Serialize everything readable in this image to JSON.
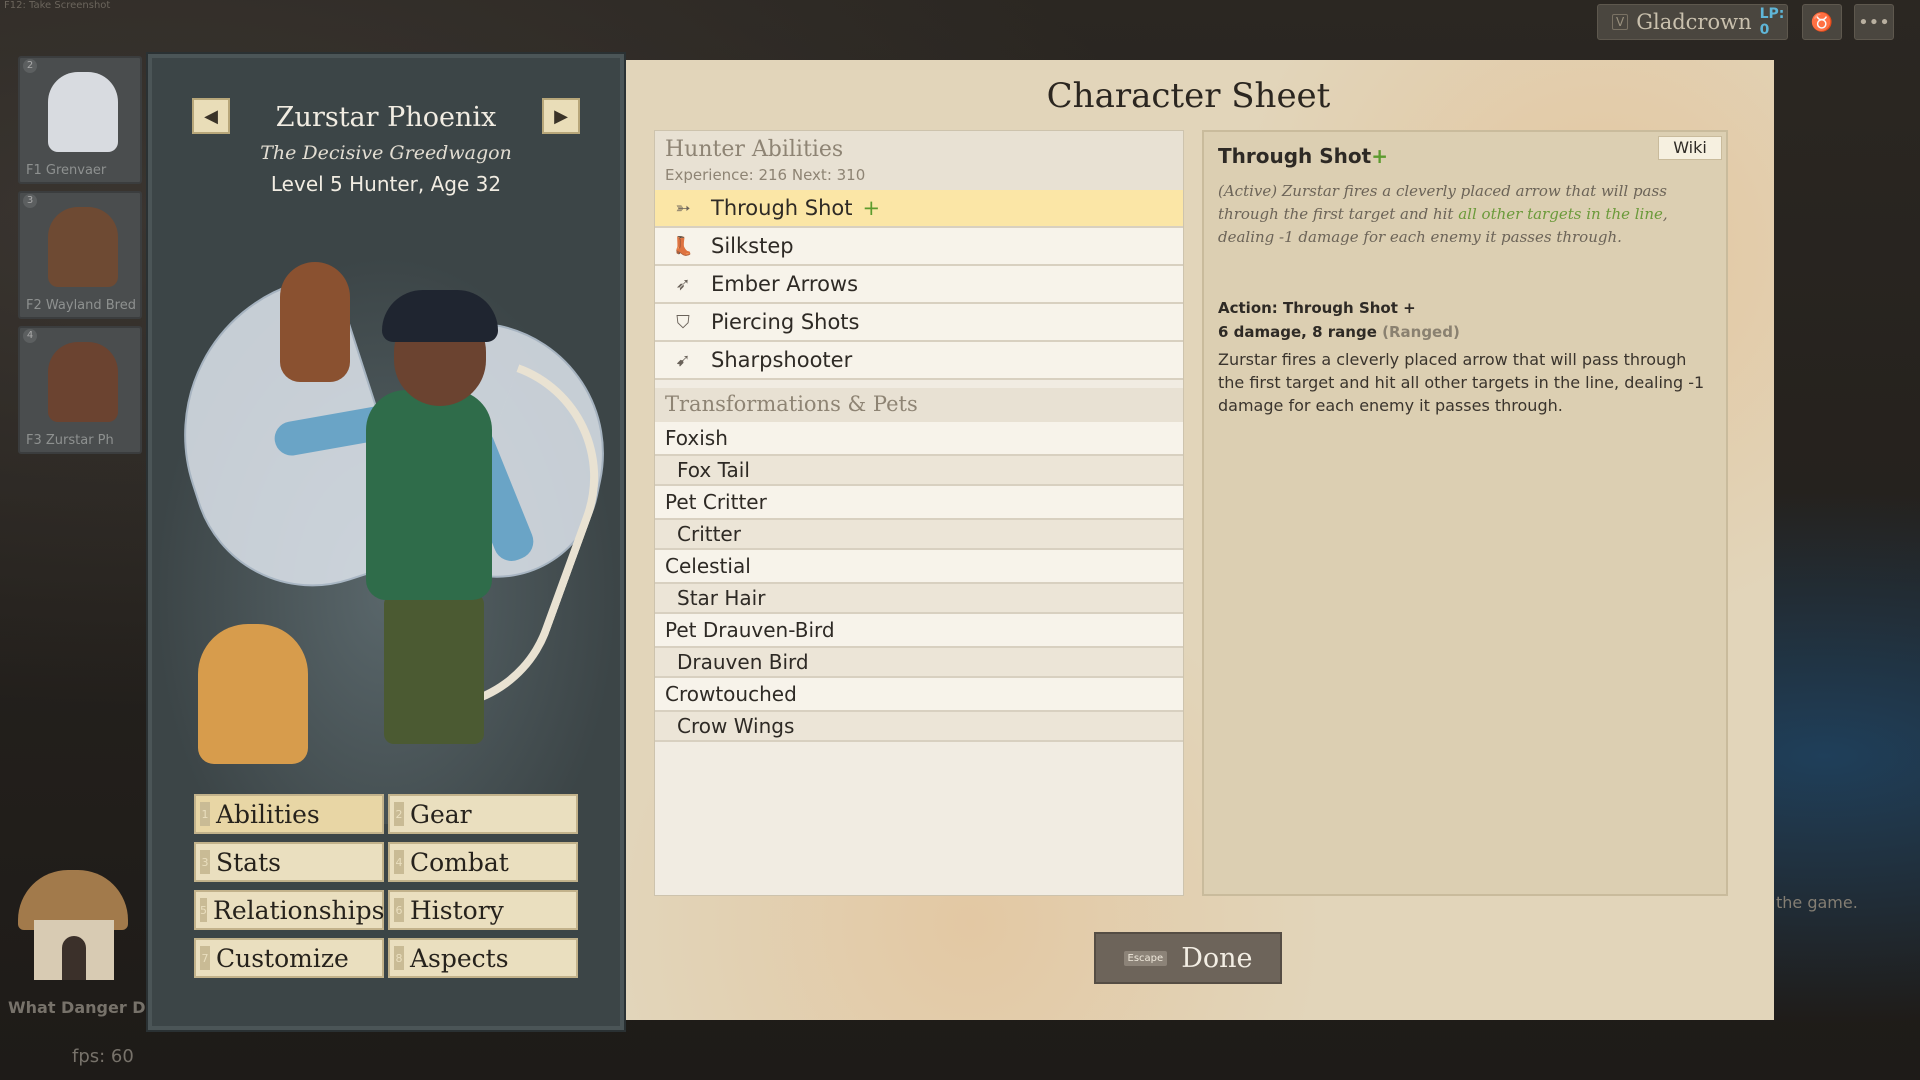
{
  "overlay": {
    "screenshot_hint": "F12: Take Screenshot",
    "fps": "fps: 60",
    "quest": "What Danger D",
    "game_hint": "the game."
  },
  "topbar": {
    "realm_key": "V",
    "realm": "Gladcrown",
    "lp": "LP: 0"
  },
  "party": [
    {
      "key": "2",
      "label": "F1 Grenvaer"
    },
    {
      "key": "3",
      "label": "F2 Wayland Bred"
    },
    {
      "key": "4",
      "label": "F3 Zurstar Ph"
    }
  ],
  "character": {
    "name": "Zurstar Phoenix",
    "epithet": "The Decisive Greedwagon",
    "details": "Level 5 Hunter, Age 32"
  },
  "tabs": [
    {
      "key": "1",
      "label": "Abilities"
    },
    {
      "key": "2",
      "label": "Gear"
    },
    {
      "key": "3",
      "label": "Stats"
    },
    {
      "key": "4",
      "label": "Combat"
    },
    {
      "key": "5",
      "label": "Relationships"
    },
    {
      "key": "6",
      "label": "History"
    },
    {
      "key": "7",
      "label": "Customize"
    },
    {
      "key": "8",
      "label": "Aspects"
    }
  ],
  "sheet": {
    "title": "Character Sheet",
    "abilities_header": "Hunter Abilities",
    "experience": "Experience: 216   Next: 310",
    "abilities": [
      {
        "label": "Through Shot",
        "plus": "+",
        "icon": "arrow-icon"
      },
      {
        "label": "Silkstep",
        "plus": "",
        "icon": "boot-icon"
      },
      {
        "label": "Ember Arrows",
        "plus": "",
        "icon": "fire-arrow-icon"
      },
      {
        "label": "Piercing Shots",
        "plus": "",
        "icon": "shield-icon"
      },
      {
        "label": "Sharpshooter",
        "plus": "",
        "icon": "bow-icon"
      }
    ],
    "transform_header": "Transformations & Pets",
    "transforms": [
      {
        "label": "Foxish",
        "sub": false
      },
      {
        "label": "Fox Tail",
        "sub": true
      },
      {
        "label": "Pet Critter",
        "sub": false
      },
      {
        "label": "Critter",
        "sub": true
      },
      {
        "label": "Celestial",
        "sub": false
      },
      {
        "label": "Star Hair",
        "sub": true
      },
      {
        "label": "Pet Drauven-Bird",
        "sub": false
      },
      {
        "label": "Drauven Bird",
        "sub": true
      },
      {
        "label": "Crowtouched",
        "sub": false
      },
      {
        "label": "Crow Wings",
        "sub": true
      }
    ],
    "detail": {
      "wiki": "Wiki",
      "title": "Through Shot",
      "title_plus": "+",
      "desc_pre": "(Active) Zurstar fires a cleverly placed arrow that will pass through the first target and hit ",
      "desc_hl": "all other targets in the line",
      "desc_post": ", dealing -1 damage for each enemy it passes through.",
      "action": "Action: Through Shot +",
      "stats": "6 damage, 8 range",
      "range_type": "(Ranged)",
      "body": "Zurstar fires a cleverly placed arrow that will pass through the first target and hit all other targets in the line, dealing -1 damage for each enemy it passes through."
    },
    "done_key": "Escape",
    "done_label": "Done"
  }
}
